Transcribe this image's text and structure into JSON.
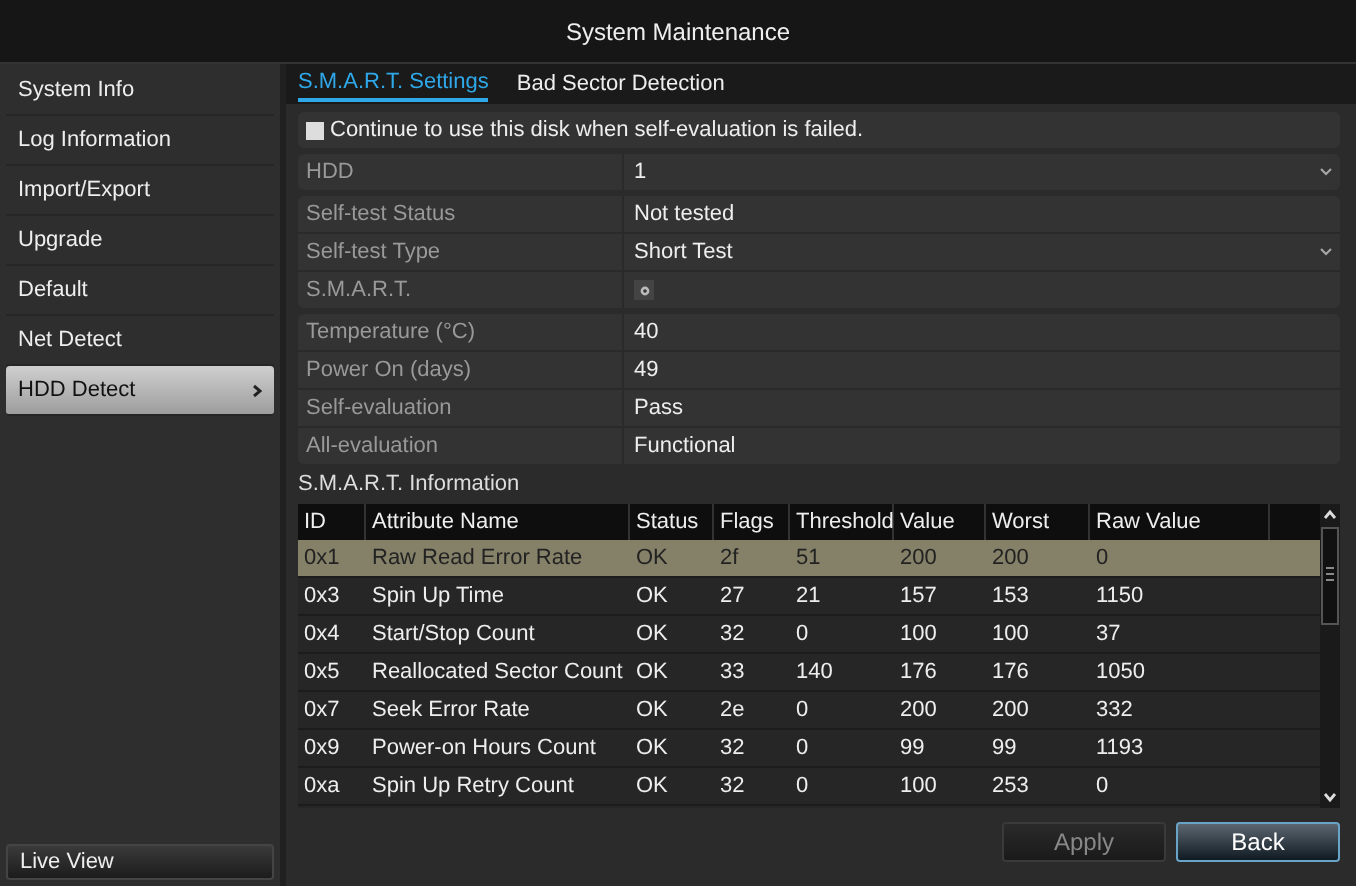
{
  "window": {
    "title": "System Maintenance"
  },
  "sidebar": {
    "items": [
      {
        "label": "System Info",
        "selected": false
      },
      {
        "label": "Log Information",
        "selected": false
      },
      {
        "label": "Import/Export",
        "selected": false
      },
      {
        "label": "Upgrade",
        "selected": false
      },
      {
        "label": "Default",
        "selected": false
      },
      {
        "label": "Net Detect",
        "selected": false
      },
      {
        "label": "HDD Detect",
        "selected": true
      }
    ],
    "bottom_button": "Live View"
  },
  "tabs": [
    {
      "label": "S.M.A.R.T. Settings",
      "selected": true
    },
    {
      "label": "Bad Sector Detection",
      "selected": false
    }
  ],
  "continue_option": {
    "label": "Continue to use this disk when self-evaluation is failed.",
    "checked": false
  },
  "form_groups": [
    [
      {
        "label": "HDD",
        "value": "1",
        "kind": "dropdown"
      }
    ],
    [
      {
        "label": "Self-test Status",
        "value": "Not tested",
        "kind": "text"
      },
      {
        "label": "Self-test Type",
        "value": "Short Test",
        "kind": "dropdown"
      },
      {
        "label": "S.M.A.R.T.",
        "kind": "button"
      }
    ],
    [
      {
        "label": "Temperature (°C)",
        "value": "40",
        "kind": "text"
      },
      {
        "label": "Power On (days)",
        "value": "49",
        "kind": "text"
      },
      {
        "label": "Self-evaluation",
        "value": "Pass",
        "kind": "text"
      },
      {
        "label": "All-evaluation",
        "value": "Functional",
        "kind": "text"
      }
    ]
  ],
  "smart_info": {
    "title": "S.M.A.R.T. Information",
    "columns": [
      "ID",
      "Attribute Name",
      "Status",
      "Flags",
      "Threshold",
      "Value",
      "Worst",
      "Raw Value"
    ],
    "rows": [
      {
        "cells": [
          "0x1",
          "Raw Read Error Rate",
          "OK",
          "2f",
          "51",
          "200",
          "200",
          "0"
        ],
        "selected": true
      },
      {
        "cells": [
          "0x3",
          "Spin Up Time",
          "OK",
          "27",
          "21",
          "157",
          "153",
          "1150"
        ],
        "selected": false
      },
      {
        "cells": [
          "0x4",
          "Start/Stop Count",
          "OK",
          "32",
          "0",
          "100",
          "100",
          "37"
        ],
        "selected": false
      },
      {
        "cells": [
          "0x5",
          "Reallocated Sector Count",
          "OK",
          "33",
          "140",
          "176",
          "176",
          "1050"
        ],
        "selected": false
      },
      {
        "cells": [
          "0x7",
          "Seek Error Rate",
          "OK",
          "2e",
          "0",
          "200",
          "200",
          "332"
        ],
        "selected": false
      },
      {
        "cells": [
          "0x9",
          "Power-on Hours Count",
          "OK",
          "32",
          "0",
          "99",
          "99",
          "1193"
        ],
        "selected": false
      },
      {
        "cells": [
          "0xa",
          "Spin Up Retry Count",
          "OK",
          "32",
          "0",
          "100",
          "253",
          "0"
        ],
        "selected": false
      }
    ]
  },
  "buttons": [
    {
      "label": "Apply",
      "disabled": true
    },
    {
      "label": "Back",
      "disabled": false
    }
  ]
}
